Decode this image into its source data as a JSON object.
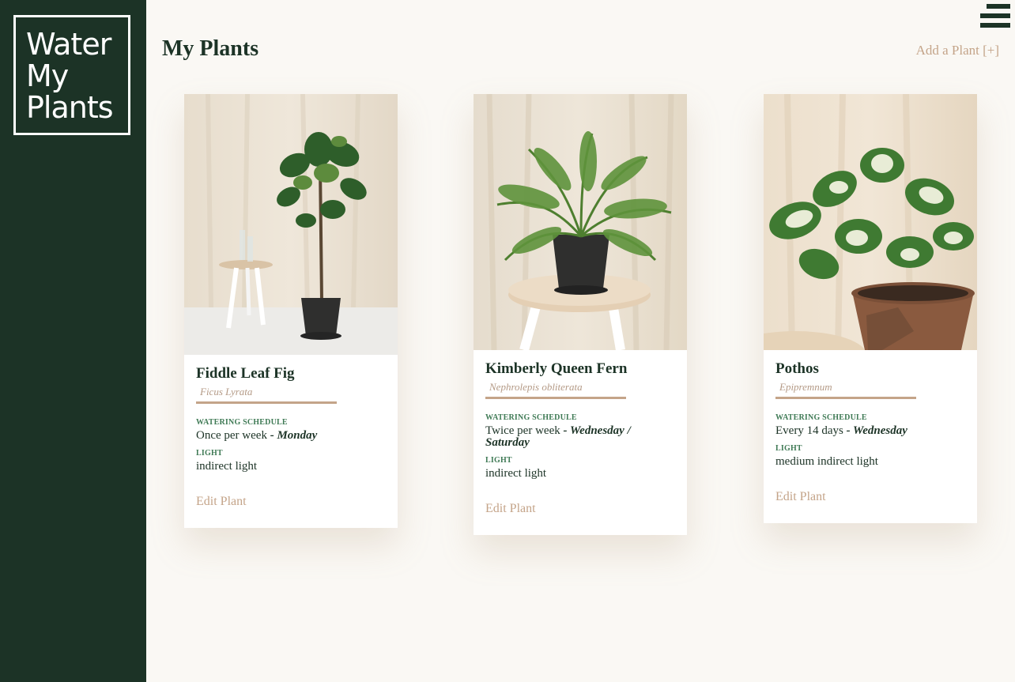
{
  "logo": {
    "lines": [
      "Water",
      "My",
      "Plants"
    ]
  },
  "page": {
    "title": "My Plants",
    "add_plant_label": "Add a Plant [+]"
  },
  "labels": {
    "watering": "WATERING SCHEDULE",
    "light": "LIGHT",
    "edit": "Edit Plant"
  },
  "plants": [
    {
      "name": "Fiddle Leaf Fig",
      "scientific": "Ficus Lyrata",
      "frequency": "Once per week",
      "day": "- Monday",
      "light": "indirect light"
    },
    {
      "name": "Kimberly Queen Fern",
      "scientific": "Nephrolepis obliterata",
      "frequency": "Twice per week",
      "day": "- Wednesday / Saturday",
      "light": "indirect light"
    },
    {
      "name": "Pothos",
      "scientific": "Epipremnum",
      "frequency": "Every 14 days",
      "day": "- Wednesday",
      "light": "medium indirect light"
    }
  ],
  "colors": {
    "sidebar": "#1c3326",
    "accent": "#c4a489",
    "label_green": "#3f7a55",
    "text_dark": "#1c3326",
    "background": "#faf8f4"
  },
  "icons": {
    "menu": "hamburger-menu-icon"
  }
}
